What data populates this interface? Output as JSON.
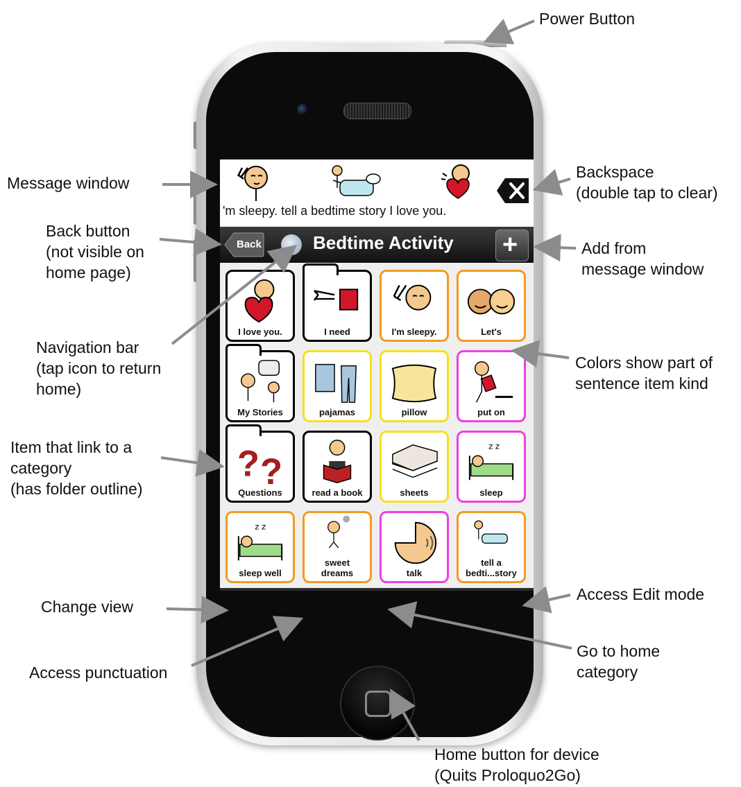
{
  "annotations": {
    "power_button": "Power Button",
    "message_window": "Message window",
    "backspace": "Backspace\n(double tap to clear)",
    "back_button": "Back button\n(not visible on\nhome page)",
    "add_from_message": "Add from\nmessage window",
    "navigation_bar": "Navigation bar\n(tap icon to return\nhome)",
    "colors_show": "Colors show part of\nsentence item kind",
    "item_link": "Item that link to a\ncategory\n(has folder outline)",
    "change_view": "Change view",
    "access_edit": "Access Edit mode",
    "access_punctuation": "Access punctuation",
    "go_home_category": "Go to home\ncategory",
    "home_button_device": "Home button for device\n(Quits Proloquo2Go)"
  },
  "app": {
    "message_text": "'m sleepy. tell a bedtime story I love you.",
    "back_label": "Back",
    "nav_title": "Bedtime Activity",
    "add_label": "+",
    "punct_label": ", . ? !"
  },
  "tiles": [
    {
      "label": "I love you.",
      "border": "#000000",
      "icon": "heart-person-icon",
      "folder": false
    },
    {
      "label": "I need",
      "border": "#000000",
      "icon": "need-icon",
      "folder": true
    },
    {
      "label": "I'm sleepy.",
      "border": "#f39a1e",
      "icon": "sleepy-icon",
      "folder": false
    },
    {
      "label": "Let's",
      "border": "#f39a1e",
      "icon": "faces-icon",
      "folder": false
    },
    {
      "label": "My Stories",
      "border": "#000000",
      "icon": "stories-icon",
      "folder": true
    },
    {
      "label": "pajamas",
      "border": "#f4e21a",
      "icon": "pajamas-icon",
      "folder": false
    },
    {
      "label": "pillow",
      "border": "#f4e21a",
      "icon": "pillow-icon",
      "folder": false
    },
    {
      "label": "put on",
      "border": "#f03fe0",
      "icon": "put-on-icon",
      "folder": false
    },
    {
      "label": "Questions",
      "border": "#000000",
      "icon": "questions-icon",
      "folder": true
    },
    {
      "label": "read a book",
      "border": "#000000",
      "icon": "read-book-icon",
      "folder": false
    },
    {
      "label": "sheets",
      "border": "#f4e21a",
      "icon": "sheets-icon",
      "folder": false
    },
    {
      "label": "sleep",
      "border": "#f03fe0",
      "icon": "sleep-icon",
      "folder": false
    },
    {
      "label": "sleep well",
      "border": "#f39a1e",
      "icon": "sleep-well-icon",
      "folder": false
    },
    {
      "label": "sweet\ndreams",
      "border": "#f39a1e",
      "icon": "dreams-icon",
      "folder": false
    },
    {
      "label": "talk",
      "border": "#f03fe0",
      "icon": "talk-icon",
      "folder": false
    },
    {
      "label": "tell a\nbedti...story",
      "border": "#f39a1e",
      "icon": "story-icon",
      "folder": false
    }
  ]
}
